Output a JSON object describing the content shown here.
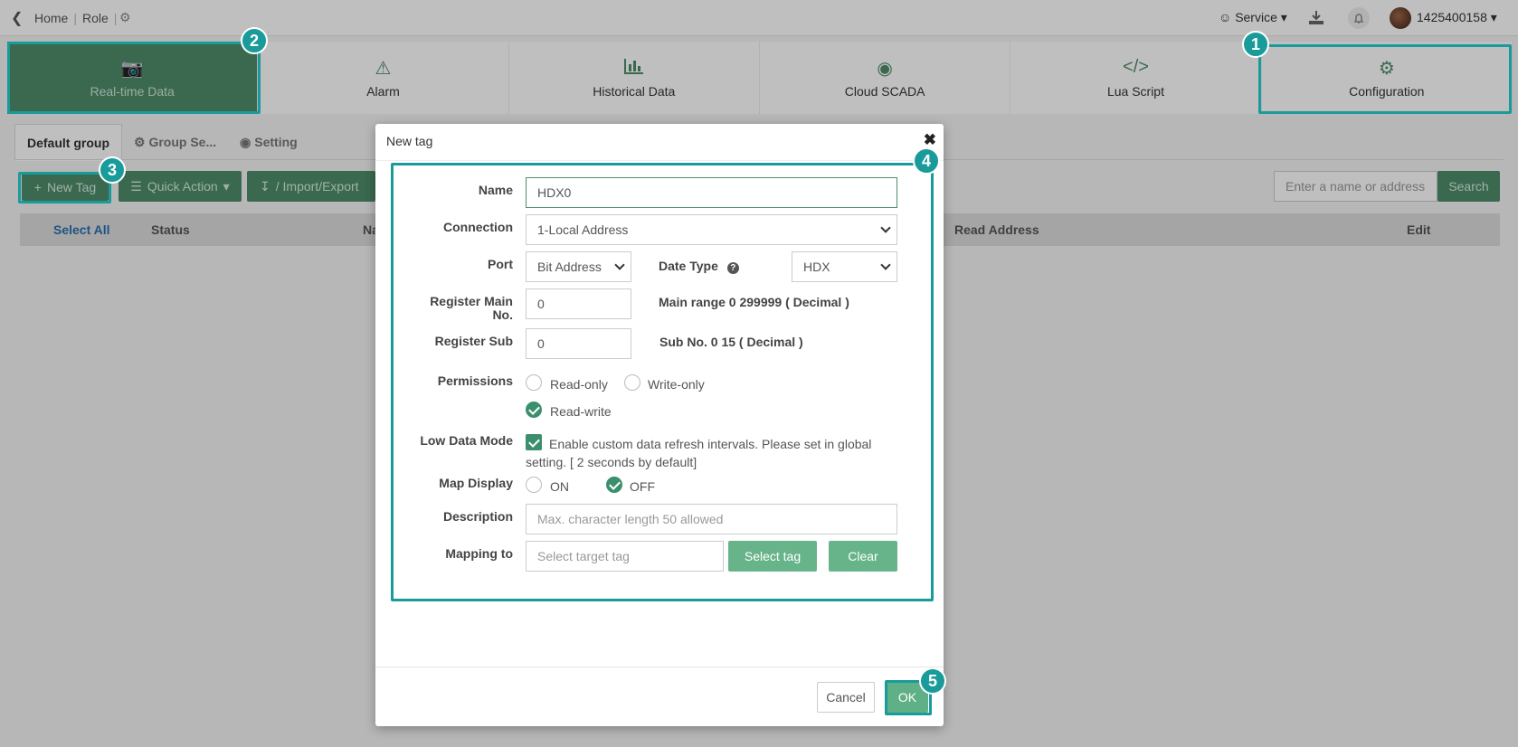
{
  "topbar": {
    "breadcrumb": [
      "Home",
      "Role"
    ],
    "service_label": "Service",
    "user_label": "1425400158"
  },
  "nav": [
    {
      "label": "Real-time Data",
      "icon": "camera-icon"
    },
    {
      "label": "Alarm",
      "icon": "warning-icon"
    },
    {
      "label": "Historical Data",
      "icon": "bar-chart-icon"
    },
    {
      "label": "Cloud SCADA",
      "icon": "palette-icon"
    },
    {
      "label": "Lua Script",
      "icon": "code-icon"
    },
    {
      "label": "Configuration",
      "icon": "gear-icon"
    }
  ],
  "tabs": [
    "Default group",
    "Group Se...",
    "Setting"
  ],
  "toolbar": {
    "new_tag": "New Tag",
    "quick_action": "Quick Action",
    "import_export": "/ Import/Export",
    "search_placeholder": "Enter a name or address",
    "search_button": "Search"
  },
  "table": {
    "select_all": "Select All",
    "columns": [
      "Status",
      "Na",
      "Read Address",
      "Edit"
    ]
  },
  "badges": [
    "1",
    "2",
    "3",
    "4",
    "5"
  ],
  "modal": {
    "title": "New tag",
    "name_label": "Name",
    "name_value": "HDX0",
    "connection_label": "Connection",
    "connection_value": "1-Local Address",
    "port_label": "Port",
    "port_value": "Bit Address",
    "date_type_label": "Date Type",
    "date_type_value": "HDX",
    "reg_main_label": "Register Main No.",
    "reg_main_value": "0",
    "reg_main_note": "Main range 0 299999 ( Decimal )",
    "reg_sub_label": "Register Sub",
    "reg_sub_value": "0",
    "reg_sub_note": "Sub No. 0 15 ( Decimal )",
    "permissions_label": "Permissions",
    "perm_read_only": "Read-only",
    "perm_write_only": "Write-only",
    "perm_read_write": "Read-write",
    "low_data_label": "Low Data Mode",
    "low_data_text": "Enable custom data refresh intervals. Please set in global setting. [ 2 seconds by default]",
    "map_display_label": "Map Display",
    "map_on": "ON",
    "map_off": "OFF",
    "description_label": "Description",
    "description_placeholder": "Max. character length 50 allowed",
    "mapping_label": "Mapping to",
    "mapping_placeholder": "Select target tag",
    "select_tag": "Select tag",
    "clear": "Clear",
    "cancel": "Cancel",
    "ok": "OK"
  },
  "colors": {
    "accent": "#4e8d6a",
    "highlight": "#1a9b9b"
  }
}
